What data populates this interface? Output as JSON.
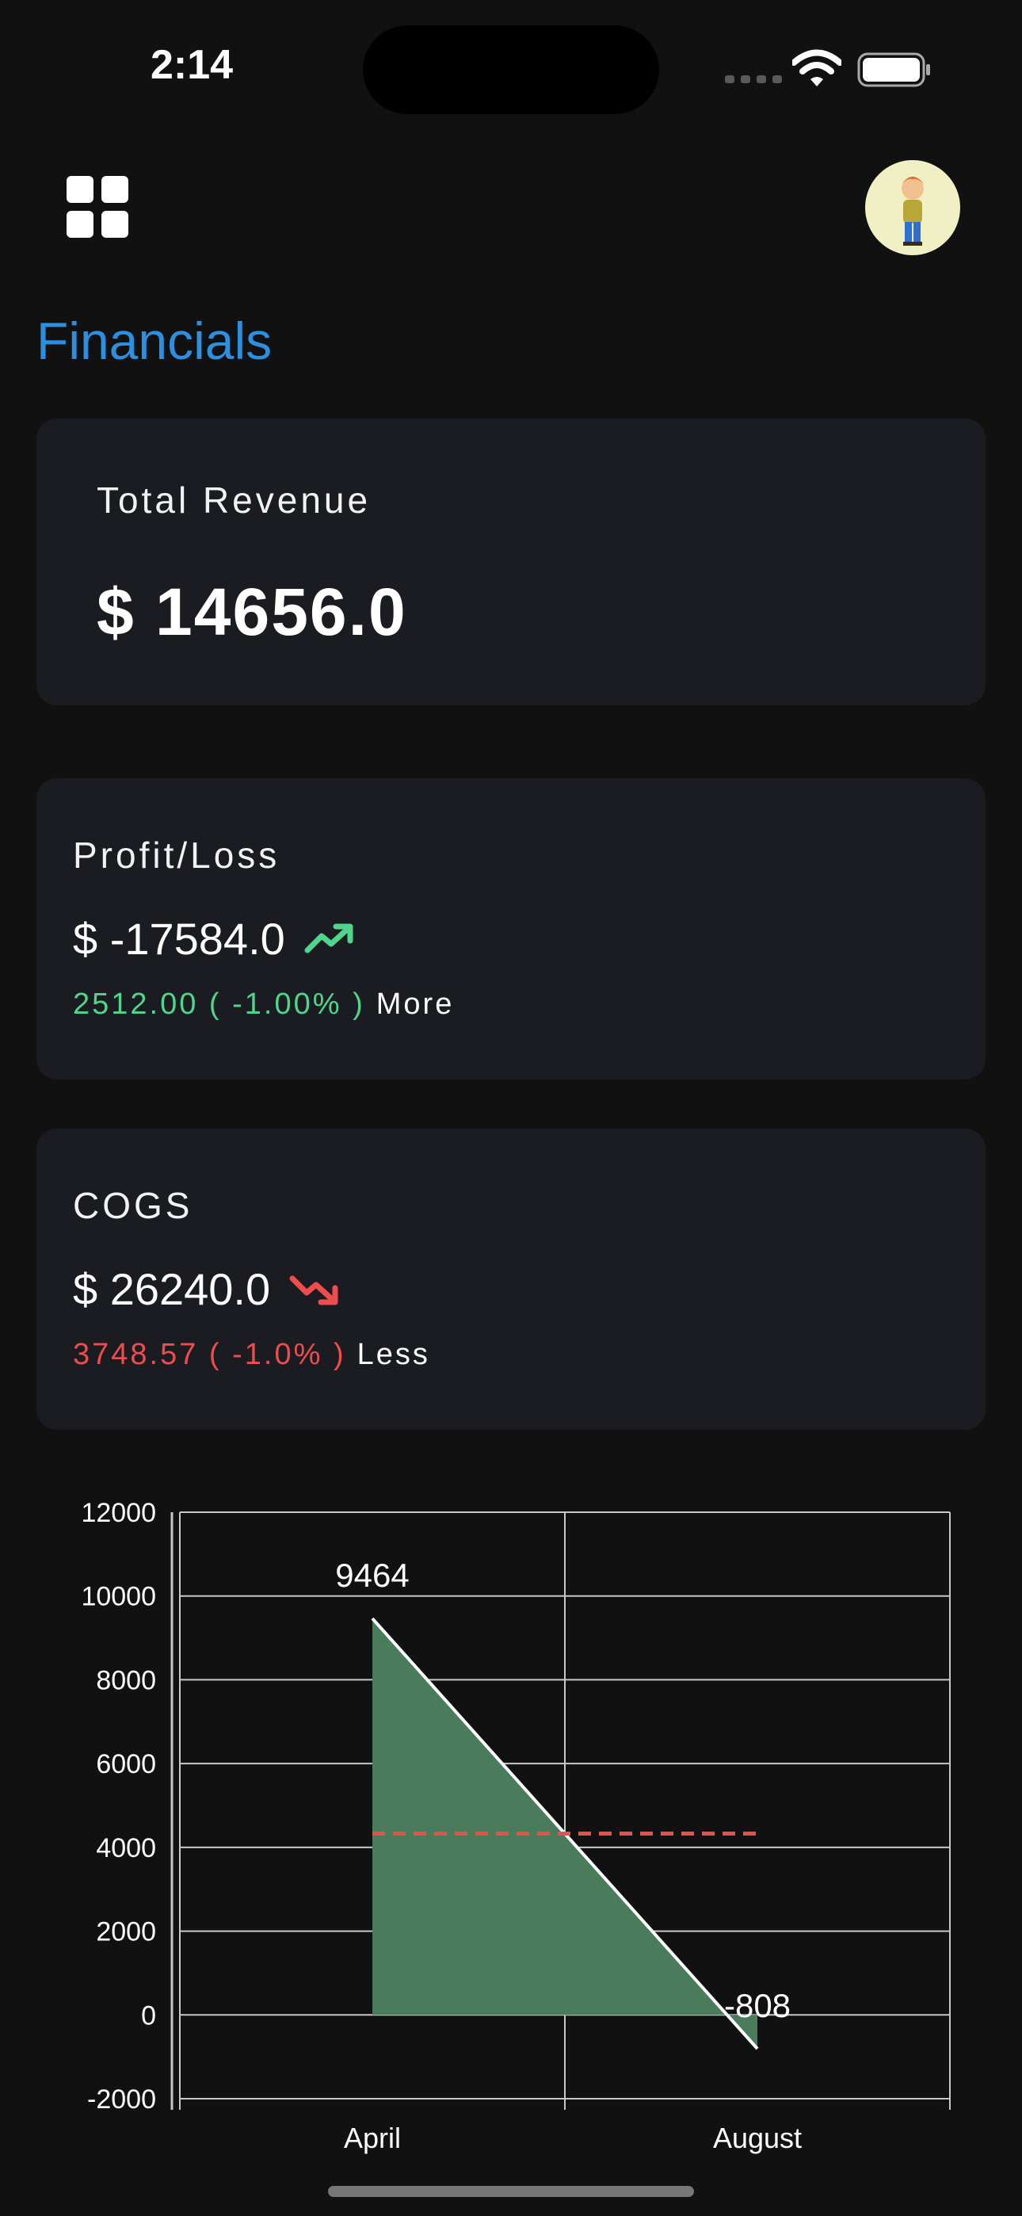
{
  "status_bar": {
    "time": "2:14"
  },
  "header": {
    "title": "Financials"
  },
  "cards": {
    "revenue": {
      "label": "Total Revenue",
      "value": "$ 14656.0"
    },
    "profit": {
      "label": "Profit/Loss",
      "value": "$ -17584.0",
      "trend_icon": "trending-up-icon",
      "change": "2512.00 ( -1.00% )",
      "link": "More",
      "color": "#4fd68c"
    },
    "cogs": {
      "label": "COGS",
      "value": "$ 26240.0",
      "trend_icon": "trending-down-icon",
      "change": "3748.57 ( -1.0% )",
      "link": "Less",
      "color": "#ee4d4d"
    }
  },
  "colors": {
    "accent": "#2c8fe0",
    "area": "#4a7c5c",
    "average_line": "#e85050"
  },
  "chart_data": {
    "type": "area",
    "categories": [
      "April",
      "August"
    ],
    "series": [
      {
        "values": [
          9464,
          -808
        ]
      }
    ],
    "data_labels": [
      "9464",
      "-808"
    ],
    "reference_line": 4328,
    "ylim": [
      -2000,
      12000
    ],
    "yticks": [
      -2000,
      0,
      2000,
      4000,
      6000,
      8000,
      10000,
      12000
    ],
    "grid": true
  }
}
